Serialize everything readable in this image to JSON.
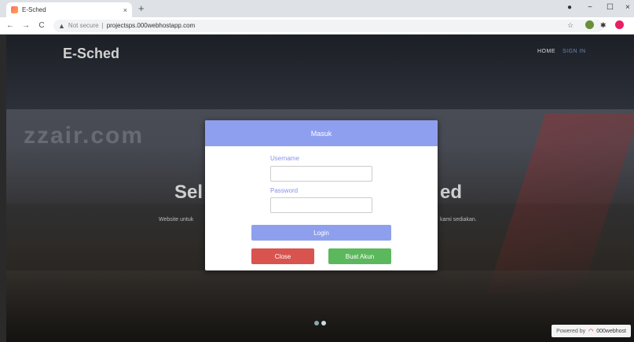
{
  "browser": {
    "tab_title": "E-Sched",
    "tab_close": "×",
    "new_tab": "+",
    "win_min": "−",
    "win_max": "☐",
    "win_close": "×",
    "back": "←",
    "forward": "→",
    "reload": "C",
    "security_label": "Not secure",
    "url": "projectsps.000webhostapp.com"
  },
  "site": {
    "brand": "E-Sched",
    "nav": {
      "home": "HOME",
      "signin": "SIGN IN"
    },
    "hero_title_left": "Sel",
    "hero_title_right": "ed",
    "hero_sub_left": "Website untuk",
    "hero_sub_right": "kami sediakan.",
    "ghost_text": "zzair.com"
  },
  "modal": {
    "title": "Masuk",
    "username_label": "Username",
    "password_label": "Password",
    "username_value": "",
    "password_value": "",
    "login_button": "Login",
    "close_button": "Close",
    "create_button": "Buat Akun"
  },
  "footer": {
    "powered_by": "Powered by",
    "brand": "000webhost"
  },
  "colors": {
    "modal_header": "#8f9ff0",
    "login": "#8ea0ed",
    "close": "#d9534f",
    "create": "#5cb85c"
  }
}
